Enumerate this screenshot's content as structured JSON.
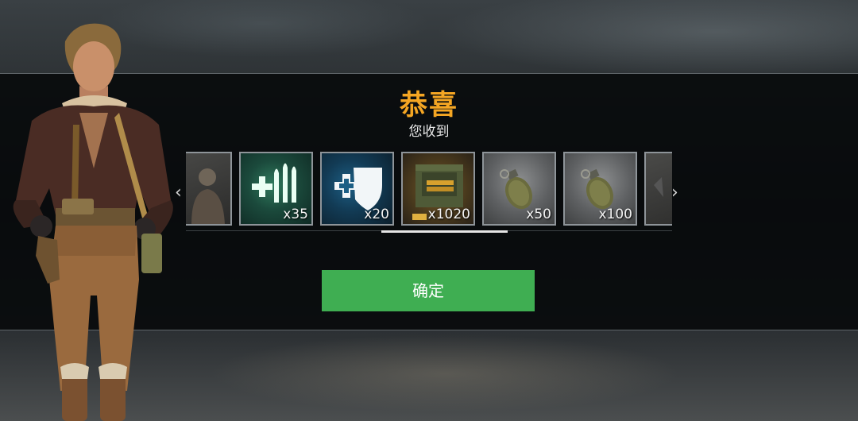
{
  "dialog": {
    "title": "恭喜",
    "subtitle": "您收到",
    "confirm_label": "确定"
  },
  "carousel": {
    "left_arrow": "‹",
    "right_arrow": "›",
    "items": [
      {
        "name": "character-card-icon",
        "quantity": ""
      },
      {
        "name": "medkit-ammo-icon",
        "quantity": "x35"
      },
      {
        "name": "medical-shield-icon",
        "quantity": "x20"
      },
      {
        "name": "ammo-box-icon",
        "quantity": "x1020"
      },
      {
        "name": "grenade-icon",
        "quantity": "x50"
      },
      {
        "name": "grenade-icon",
        "quantity": "x100"
      },
      {
        "name": "partial-item-icon",
        "quantity": ""
      }
    ]
  },
  "colors": {
    "title": "#f5a623",
    "confirm_button": "#3fae52",
    "band": "#05070880"
  }
}
